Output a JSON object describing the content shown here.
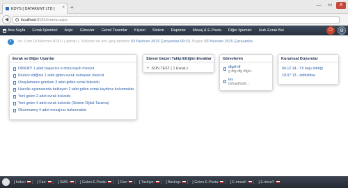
{
  "browser": {
    "tab_title": "EDYS [ DATAKENT LTD ]",
    "tab_close": "×",
    "new_tab": "+",
    "back": "◀",
    "url_host": "localhost",
    "url_path": ":8181/emenu.aspx",
    "win_min": "—",
    "win_max": "▭",
    "win_close": "✕"
  },
  "menu": {
    "items": [
      "Ana Sayfa",
      "Evrak İşlemleri",
      "Arşiv",
      "Görevler",
      "Genel Tanımlar",
      "Kişisel",
      "Sistem",
      "Raporlar",
      "Mesaj & E-Posta",
      "Diğer İşlemler",
      "Hızlı Evrak Bul"
    ]
  },
  "info": {
    "icon": "i",
    "user": "Sn. Uzm.Dr.Mehmet ATALI ( admin ).",
    "middle": "Sisteme en son giriş tarihiniz",
    "last_login": "03 Haziran 2015 Çarşamba 09:15.",
    "today_label": "Bugün",
    "today": "03 Haziran 2015 Çarşamba"
  },
  "panels": {
    "warnings": {
      "title": "Evrak ve Diğer Uyarılar",
      "items": [
        "DİKKAT! 1 adet başarısız e-imza kaydı mevcut",
        "Rezerv ettiğiniz 1 adet giden evrak numarası mevcut",
        "Onaylamanız gereken 3 adet giden evrak bulundu",
        "Hazırlık aşamasında bekleyen 2 adet giden evrak kaydınız bulunmakta",
        "Yeni gelen 2 adet evrak bulundu",
        "Yeni gelen 4 adet evrak bulundu (Sistem Dijital-Tarama)",
        "Okunmamış 4 adet mesajınız bulunmakta"
      ]
    },
    "overdue": {
      "title": "Süresi Geçen Takip Ettiğim Evraklar",
      "item": "SON TEST ( 1 Evrak )"
    },
    "tasks": {
      "title": "Görevlerim",
      "messages": [
        {
          "from": "dfgdf df",
          "body": "g dfg dfg dfgd..."
        },
        {
          "from": "tes",
          "body": "dsfsadfsafs..."
        }
      ]
    },
    "announcements": {
      "title": "Kurumsal Duyurular",
      "items": [
        "04.12.14 - Yıl başı tebriği",
        "18.07.13 - dsfdsfdsa"
      ]
    }
  },
  "statusbar": {
    "items": [
      "[ İndex:",
      "[ Fax:",
      "[ SMS:",
      "[ Gelen E-Posta:",
      "[ Dox:",
      "[ Tashiye:",
      "[ Backup:",
      "[ Gelen E-Posta:",
      "[ E-imzaK:",
      "[ E-imzaT:"
    ]
  }
}
